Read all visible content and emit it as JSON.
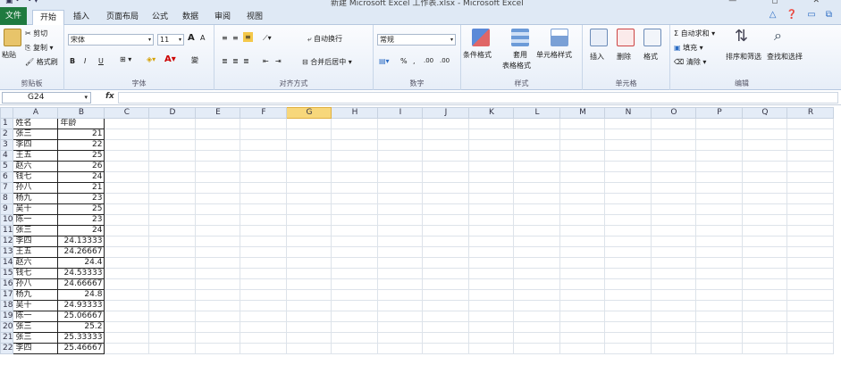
{
  "titlebar": {
    "title": "新建 Microsoft Excel 工作表.xlsx - Microsoft Excel",
    "quick_access": "▣ ↶ ↷ ▾",
    "window_controls": "— ◻ ✕"
  },
  "tabs": [
    "文件",
    "开始",
    "插入",
    "页面布局",
    "公式",
    "数据",
    "审阅",
    "视图"
  ],
  "ribbon": {
    "clipboard": {
      "label": "剪贴板",
      "paste": "粘贴",
      "cut": "剪切",
      "copy": "复制 ▾",
      "format_painter": "格式刷"
    },
    "font": {
      "label": "字体",
      "font_name": "宋体",
      "font_size": "11",
      "grow": "A",
      "shrink": "A",
      "bold": "B",
      "italic": "I",
      "underline": "U",
      "phonetic": "變"
    },
    "alignment": {
      "label": "对齐方式",
      "wrap_text": "自动换行",
      "merge_center": "合并后居中 ▾"
    },
    "number": {
      "label": "数字",
      "format": "常规",
      "percent": "%",
      "comma": ",",
      "inc_decimal": ".00",
      "dec_decimal": ".00"
    },
    "styles": {
      "label": "样式",
      "conditional": "条件格式",
      "table": "套用\n表格格式",
      "table_line1": "套用",
      "table_line2": "表格格式",
      "cell_styles": "单元格样式"
    },
    "cells": {
      "label": "单元格",
      "insert": "插入",
      "delete": "删除",
      "format": "格式"
    },
    "editing": {
      "label": "编辑",
      "autosum": "Σ 自动求和 ▾",
      "fill": "填充 ▾",
      "clear": "清除 ▾",
      "sort": "排序和筛选",
      "find": "查找和选择"
    }
  },
  "formula_bar": {
    "name_box": "G24",
    "fx": "fx",
    "value": ""
  },
  "columns": [
    "A",
    "B",
    "C",
    "D",
    "E",
    "F",
    "G",
    "H",
    "I",
    "J",
    "K",
    "L",
    "M",
    "N",
    "O",
    "P",
    "Q",
    "R"
  ],
  "selected_column": "G",
  "rows": [
    [
      "姓名",
      "年龄"
    ],
    [
      "张三",
      "21"
    ],
    [
      "李四",
      "22"
    ],
    [
      "王五",
      "25"
    ],
    [
      "赵六",
      "26"
    ],
    [
      "钱七",
      "24"
    ],
    [
      "孙八",
      "21"
    ],
    [
      "杨九",
      "23"
    ],
    [
      "吴十",
      "25"
    ],
    [
      "陈一",
      "23"
    ],
    [
      "张三",
      "24"
    ],
    [
      "李四",
      "24.13333"
    ],
    [
      "王五",
      "24.26667"
    ],
    [
      "赵六",
      "24.4"
    ],
    [
      "钱七",
      "24.53333"
    ],
    [
      "孙八",
      "24.66667"
    ],
    [
      "杨九",
      "24.8"
    ],
    [
      "吴十",
      "24.93333"
    ],
    [
      "陈一",
      "25.06667"
    ],
    [
      "张三",
      "25.2"
    ],
    [
      "张三",
      "25.33333"
    ],
    [
      "李四",
      "25.46667"
    ]
  ],
  "row_numbers": [
    "1",
    "2",
    "3",
    "4",
    "5",
    "6",
    "7",
    "8",
    "9",
    "10",
    "11",
    "12",
    "13",
    "14",
    "15",
    "16",
    "17",
    "18",
    "19",
    "20",
    "21",
    "22"
  ]
}
